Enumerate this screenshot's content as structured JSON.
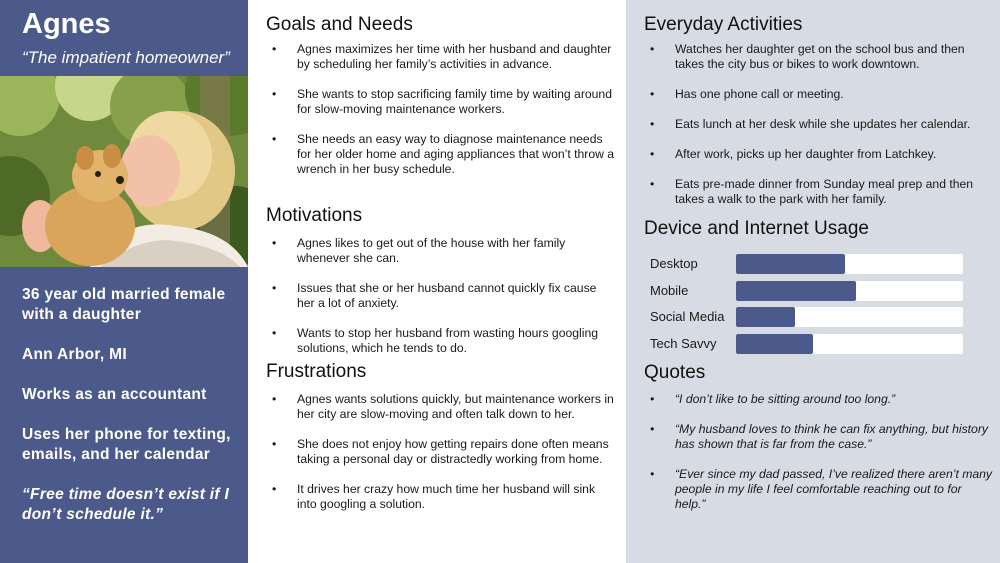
{
  "persona": {
    "name": "Agnes",
    "tagline": "“The impatient homeowner”",
    "facts": [
      "36 year old married female with a daughter",
      "Ann Arbor, MI",
      "Works as an accountant",
      "Uses her phone for texting, emails, and her calendar",
      "“Free time doesn’t exist if I don’t schedule it.”"
    ]
  },
  "goals": {
    "title": "Goals and Needs",
    "items": [
      "Agnes maximizes her time with her husband and daughter by scheduling her family’s activities in advance.",
      "She wants to stop sacrificing family time by waiting around for slow-moving maintenance workers.",
      "She needs an easy way to diagnose maintenance needs for her older home and aging appliances that won’t throw a wrench in her busy schedule."
    ]
  },
  "motivations": {
    "title": "Motivations",
    "items": [
      "Agnes likes to get out of the house with her family whenever she can.",
      "Issues that she or her husband cannot quickly fix cause her a lot of anxiety.",
      "Wants to stop her husband from wasting hours googling solutions, which he tends to do."
    ]
  },
  "frustrations": {
    "title": "Frustrations",
    "items": [
      "Agnes wants solutions quickly, but maintenance workers in her city are slow-moving and often talk down to her.",
      "She does not enjoy how getting repairs done often means taking a personal day or distractedly working from home.",
      "It drives her crazy how much time her husband will sink into googling a solution."
    ]
  },
  "activities": {
    "title": "Everyday Activities",
    "items": [
      "Watches her daughter get on the school bus and then takes the city bus or bikes to work downtown.",
      "Has one phone call or meeting.",
      "Eats lunch at her desk while she updates her calendar.",
      "After work, picks up her daughter from Latchkey.",
      "Eats pre-made dinner from Sunday meal prep and then takes a walk to the park with her family."
    ]
  },
  "usage": {
    "title": "Device and Internet Usage",
    "rows": [
      {
        "label": "Desktop",
        "level": 0.48
      },
      {
        "label": "Mobile",
        "level": 0.53
      },
      {
        "label": "Social Media",
        "level": 0.26
      },
      {
        "label": "Tech Savvy",
        "level": 0.34
      }
    ]
  },
  "quotes": {
    "title": "Quotes",
    "items": [
      "“I don’t like to be sitting around too long.”",
      "“My husband loves to think he can fix anything, but history has shown that is far from the case.”",
      "“Ever since my dad passed, I’ve realized there aren’t many people in my life I feel comfortable reaching out to for help.”"
    ]
  },
  "colors": {
    "sidebar": "#4b5a8a",
    "right_panel": "#d7dbe4",
    "bar_fill": "#4b5a8a",
    "bar_track": "#ffffff"
  }
}
